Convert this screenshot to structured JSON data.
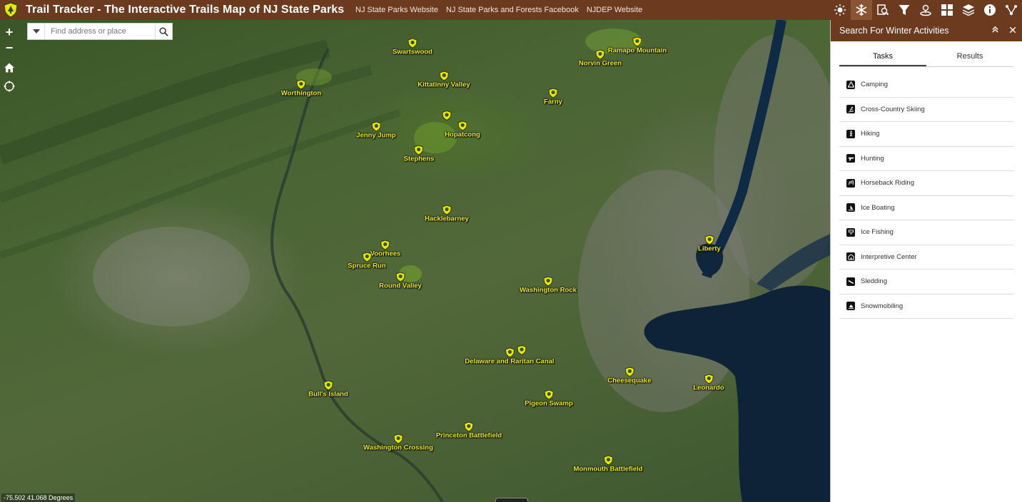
{
  "header": {
    "title": "Trail Tracker - The Interactive Trails Map of NJ State Parks",
    "links": [
      "NJ State Parks Website",
      "NJ State Parks and Forests Facebook",
      "NJDEP Website"
    ],
    "tools": [
      "sun-icon",
      "snowflake-icon",
      "search-area-icon",
      "filter-icon",
      "location-icon",
      "grid-icon",
      "layers-icon",
      "info-icon",
      "share-icon"
    ]
  },
  "map": {
    "search_placeholder": "Find address or place",
    "zoom_in": "+",
    "zoom_out": "−",
    "coordinates": "-75.502 41.068 Degrees",
    "markers": [
      {
        "name": "Swartswood"
      },
      {
        "name": "Ramapo Mountain"
      },
      {
        "name": "Norvin Green"
      },
      {
        "name": "Worthington"
      },
      {
        "name": "Kittatinny Valley"
      },
      {
        "name": "Farny"
      },
      {
        "name": "Jenny Jump"
      },
      {
        "name": "Hopatcong"
      },
      {
        "name": "Stephens"
      },
      {
        "name": "Hacklebarney"
      },
      {
        "name": "Voorhees"
      },
      {
        "name": "Spruce Run"
      },
      {
        "name": "Liberty"
      },
      {
        "name": "Round Valley"
      },
      {
        "name": "Washington Rock"
      },
      {
        "name": "Delaware and Raritan Canal"
      },
      {
        "name": "Cheesequake"
      },
      {
        "name": "Leonardo"
      },
      {
        "name": "Bull's Island"
      },
      {
        "name": "Pigeon Swamp"
      },
      {
        "name": "Princeton Battlefield"
      },
      {
        "name": "Washington Crossing"
      },
      {
        "name": "Monmouth Battlefield"
      }
    ]
  },
  "panel": {
    "title": "Search For Winter Activities",
    "tabs": [
      "Tasks",
      "Results"
    ],
    "tasks": [
      "Camping",
      "Cross-Country Skiing",
      "Hiking",
      "Hunting",
      "Horseback Riding",
      "Ice Boating",
      "Ice Fishing",
      "Interpretive Center",
      "Sledding",
      "Snowmobiling"
    ]
  }
}
